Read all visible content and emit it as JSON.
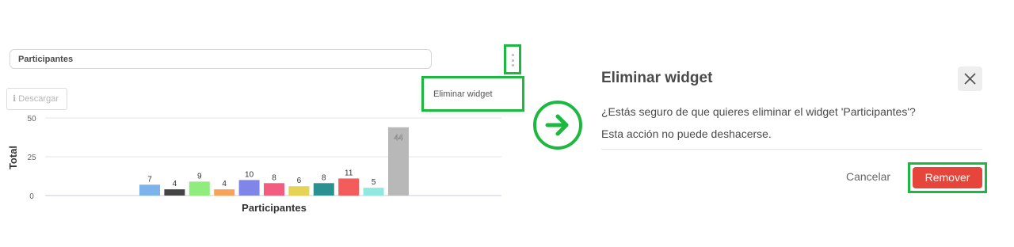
{
  "widget": {
    "title": "Participantes",
    "menu_item": "Eliminar widget",
    "download_icon": "ℹ",
    "download_label": "Descargar"
  },
  "chart_data": {
    "type": "bar",
    "ylabel": "Total",
    "xlabel": "Participantes",
    "ylim": [
      0,
      50
    ],
    "yticks": [
      "50",
      "25",
      "0"
    ],
    "grid": true,
    "values": [
      7,
      4,
      9,
      4,
      10,
      8,
      6,
      8,
      11,
      5,
      44
    ],
    "colors": [
      "#7cb3ea",
      "#444444",
      "#90ed7d",
      "#f7a35c",
      "#8085e9",
      "#f15c80",
      "#e4d354",
      "#2b908f",
      "#f45b5b",
      "#91e8e1",
      "#b8b8b8"
    ]
  },
  "modal": {
    "title": "Eliminar widget",
    "close_icon": "close-icon",
    "question": "¿Estás seguro de que quieres eliminar el widget 'Participantes'?",
    "note": "Esta acción no puede deshacerse.",
    "cancel_label": "Cancelar",
    "remove_label": "Remover",
    "remove_color": "#e5453b"
  },
  "arrow_icon": "arrow-right-circle-icon",
  "highlight_color": "#1db83f"
}
